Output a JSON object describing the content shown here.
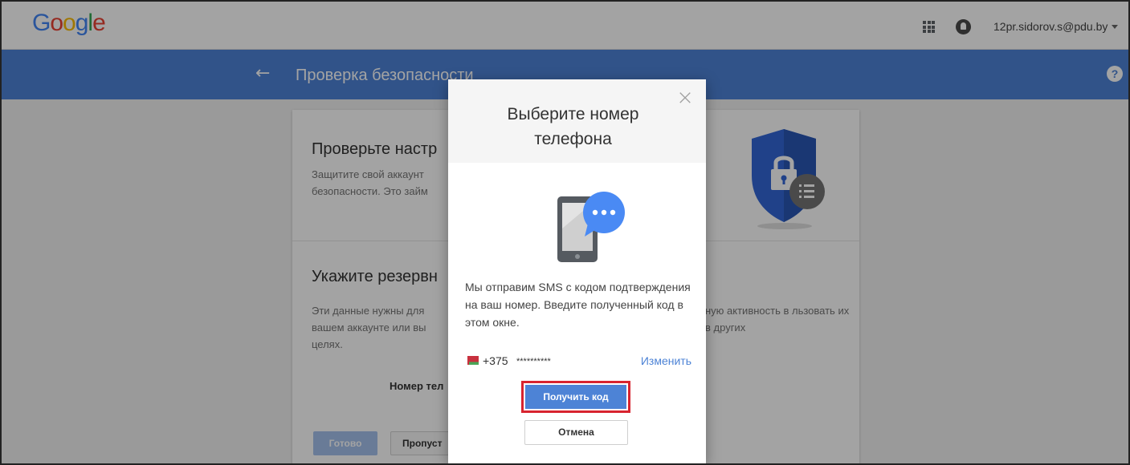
{
  "header": {
    "logo_letters": [
      {
        "ch": "G",
        "color": "#4285F4"
      },
      {
        "ch": "o",
        "color": "#EA4335"
      },
      {
        "ch": "o",
        "color": "#FBBC05"
      },
      {
        "ch": "g",
        "color": "#4285F4"
      },
      {
        "ch": "l",
        "color": "#34A853"
      },
      {
        "ch": "e",
        "color": "#EA4335"
      }
    ],
    "apps_icon": "apps-grid-icon",
    "notifications_icon": "bell-icon",
    "account_email": "12pr.sidorov.s@pdu.by"
  },
  "titlebar": {
    "back_icon": "←",
    "title": "Проверка безопасности",
    "help_icon": "?",
    "color": "#4d83d6"
  },
  "background_card": {
    "section1_heading": "Проверьте настр",
    "section1_text": "Защитите свой аккаунт безопасности. Это займ",
    "section2_heading": "Укажите резервн",
    "section2_text_left": "Эти данные нужны для вашем аккаунте или вы целях.",
    "section2_text_right": "ную активность в льзовать их в других",
    "phone_label": "Номер тел",
    "done_button": "Готово",
    "skip_button": "Пропуст"
  },
  "dialog": {
    "title": "Выберите номер телефона",
    "close_icon": "×",
    "message": "Мы отправим SMS с кодом подтверждения на ваш номер. Введите полученный код в этом окне.",
    "phone_code": "+375",
    "phone_masked": "**********",
    "change_link": "Изменить",
    "get_code_button": "Получить код",
    "cancel_button": "Отмена",
    "accent_color": "#4d83d6",
    "highlight_color": "#d8242f"
  }
}
